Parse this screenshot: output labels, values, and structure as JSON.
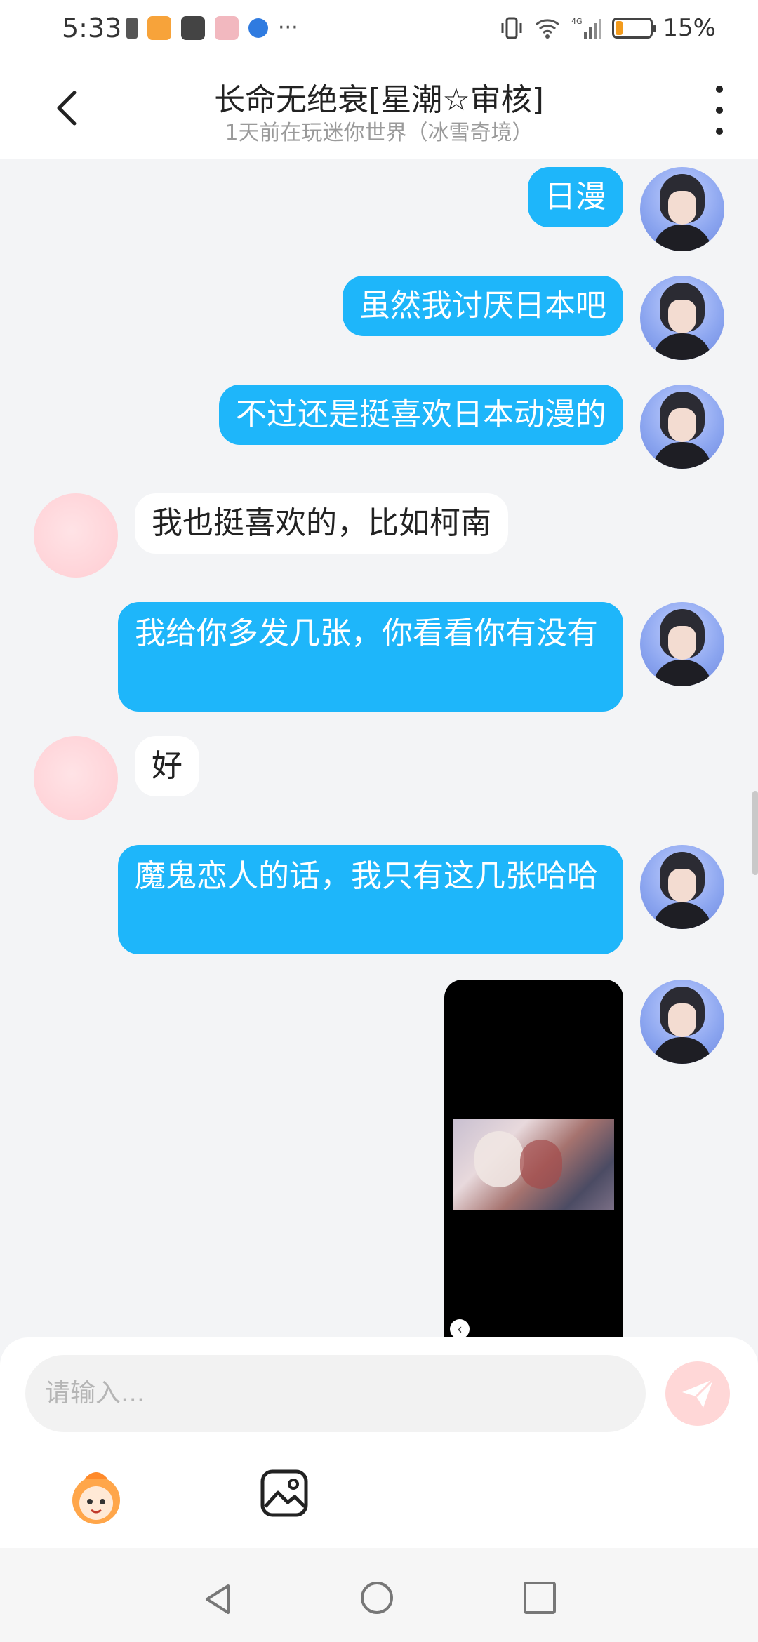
{
  "status_bar": {
    "time": "5:33",
    "battery_text": "15%",
    "battery_level": 0.15,
    "icons": [
      "usb-debug-icon",
      "video-app-icon",
      "huawei-store-icon",
      "shop-app-icon",
      "browser-icon",
      "more-notifications-icon",
      "vibrate-icon",
      "wifi-icon",
      "signal-4g-icon",
      "battery-icon"
    ],
    "more_dots": "···"
  },
  "header": {
    "title": "长命无绝衰[星潮☆审核]",
    "subtitle": "1天前在玩迷你世界（冰雪奇境）"
  },
  "messages": [
    {
      "side": "me",
      "text": "日漫"
    },
    {
      "side": "me",
      "text": "虽然我讨厌日本吧"
    },
    {
      "side": "me",
      "text": "不过还是挺喜欢日本动漫的"
    },
    {
      "side": "other",
      "text": "我也挺喜欢的，比如柯南"
    },
    {
      "side": "me",
      "text": "我给你多发几张，你看看你有没有"
    },
    {
      "side": "other",
      "text": "好"
    },
    {
      "side": "me",
      "text": "魔鬼恋人的话，我只有这几张哈哈"
    },
    {
      "side": "me",
      "type": "image"
    }
  ],
  "input": {
    "placeholder": "请输入..."
  },
  "colors": {
    "my_bubble": "#1eb6fa",
    "other_bubble": "#ffffff",
    "background": "#f3f4f6",
    "send_button": "#ffd7d7"
  }
}
